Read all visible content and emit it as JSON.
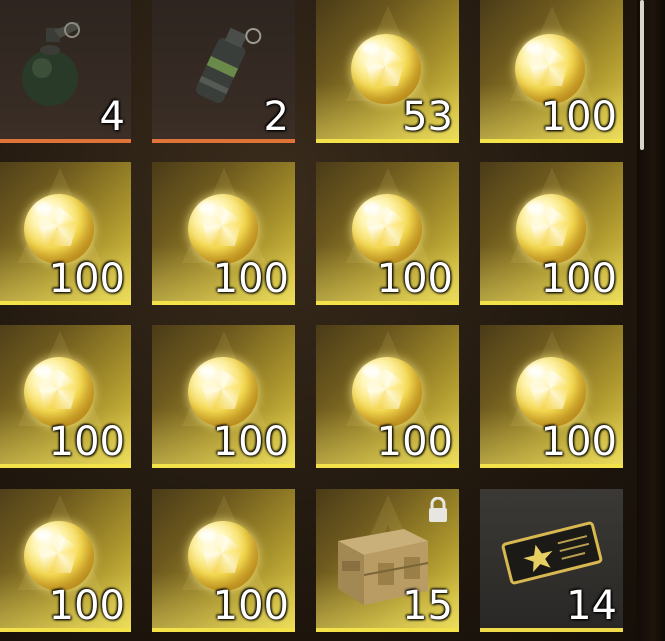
{
  "inventory": {
    "rows": [
      [
        {
          "item": "frag-grenade",
          "icon": "frag-grenade-icon",
          "qty": "4",
          "style": "dark-orange"
        },
        {
          "item": "smoke-grenade",
          "icon": "smoke-grenade-icon",
          "qty": "2",
          "style": "dark-orange"
        },
        {
          "item": "gold-gem",
          "icon": "gold-gem-icon",
          "qty": "53",
          "style": "gold"
        },
        {
          "item": "gold-gem",
          "icon": "gold-gem-icon",
          "qty": "100",
          "style": "gold"
        }
      ],
      [
        {
          "item": "gold-gem",
          "icon": "gold-gem-icon",
          "qty": "100",
          "style": "gold"
        },
        {
          "item": "gold-gem",
          "icon": "gold-gem-icon",
          "qty": "100",
          "style": "gold"
        },
        {
          "item": "gold-gem",
          "icon": "gold-gem-icon",
          "qty": "100",
          "style": "gold"
        },
        {
          "item": "gold-gem",
          "icon": "gold-gem-icon",
          "qty": "100",
          "style": "gold"
        }
      ],
      [
        {
          "item": "gold-gem",
          "icon": "gold-gem-icon",
          "qty": "100",
          "style": "gold"
        },
        {
          "item": "gold-gem",
          "icon": "gold-gem-icon",
          "qty": "100",
          "style": "gold"
        },
        {
          "item": "gold-gem",
          "icon": "gold-gem-icon",
          "qty": "100",
          "style": "gold"
        },
        {
          "item": "gold-gem",
          "icon": "gold-gem-icon",
          "qty": "100",
          "style": "gold"
        }
      ],
      [
        {
          "item": "gold-gem",
          "icon": "gold-gem-icon",
          "qty": "100",
          "style": "gold"
        },
        {
          "item": "gold-gem",
          "icon": "gold-gem-icon",
          "qty": "100",
          "style": "gold"
        },
        {
          "item": "supply-crate",
          "icon": "supply-crate-icon",
          "qty": "15",
          "style": "gold",
          "locked": true
        },
        {
          "item": "gold-ticket",
          "icon": "ticket-icon",
          "qty": "14",
          "style": "grey"
        }
      ]
    ]
  },
  "colors": {
    "gold_rarity": "#f4e24a",
    "orange_rarity": "#e07438",
    "background": "#1a1410"
  }
}
